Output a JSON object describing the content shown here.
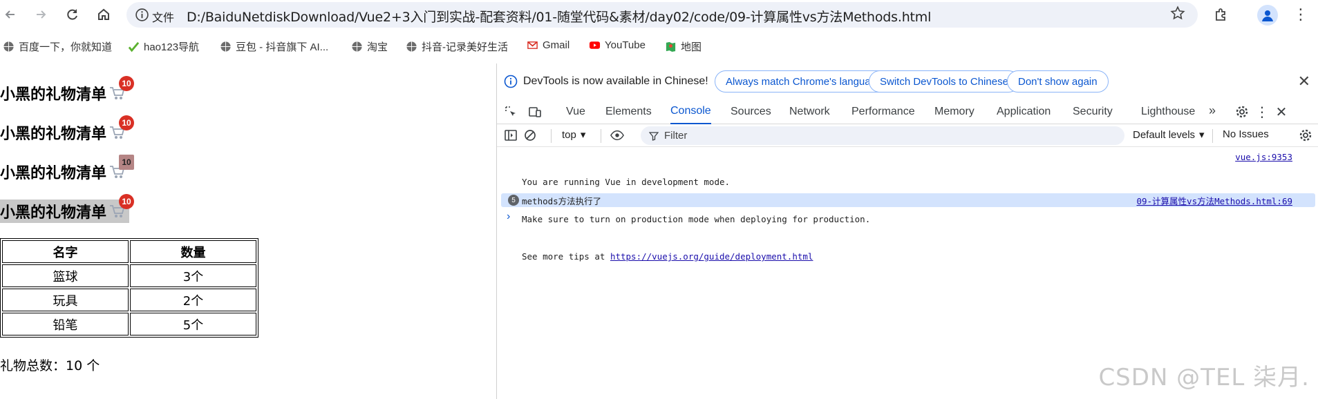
{
  "browser": {
    "omnibox": {
      "scheme_label": "文件",
      "url": "D:/BaiduNetdiskDownload/Vue2+3入门到实战-配套资料/01-随堂代码&素材/day02/code/09-计算属性vs方法Methods.html"
    },
    "bookmarks": [
      {
        "label": "百度一下，你就知道",
        "icon": "globe-icon"
      },
      {
        "label": "hao123导航",
        "icon": "hao123-icon"
      },
      {
        "label": "豆包 - 抖音旗下 AI...",
        "icon": "globe-icon"
      },
      {
        "label": "淘宝",
        "icon": "globe-icon"
      },
      {
        "label": "抖音-记录美好生活",
        "icon": "globe-icon"
      },
      {
        "label": "Gmail",
        "icon": "gmail-icon"
      },
      {
        "label": "YouTube",
        "icon": "youtube-icon"
      },
      {
        "label": "地图",
        "icon": "maps-icon"
      }
    ]
  },
  "page": {
    "titles": [
      {
        "text": "小黑的礼物清单",
        "badge": "10"
      },
      {
        "text": "小黑的礼物清单",
        "badge": "10"
      },
      {
        "text": "小黑的礼物清单",
        "badge": "10"
      },
      {
        "text": "小黑的礼物清单",
        "badge": "10"
      }
    ],
    "table": {
      "headers": [
        "名字",
        "数量"
      ],
      "rows": [
        [
          "篮球",
          "3个"
        ],
        [
          "玩具",
          "2个"
        ],
        [
          "铅笔",
          "5个"
        ]
      ]
    },
    "total_text": "礼物总数：10 个"
  },
  "devtools": {
    "infobar": {
      "message": "DevTools is now available in Chinese!",
      "btn_match": "Always match Chrome's language",
      "btn_switch": "Switch DevTools to Chinese",
      "btn_dont": "Don't show again"
    },
    "tabs": [
      "Vue",
      "Elements",
      "Console",
      "Sources",
      "Network",
      "Performance",
      "Memory",
      "Application",
      "Security",
      "Lighthouse"
    ],
    "active_tab": "Console",
    "toolbar": {
      "context": "top",
      "filter_placeholder": "Filter",
      "levels": "Default levels",
      "issues": "No Issues"
    },
    "console": {
      "vue_msg_line1": "You are running Vue in development mode.",
      "vue_msg_line2": "Make sure to turn on production mode when deploying for production.",
      "vue_msg_line3_prefix": "See more tips at ",
      "vue_msg_link": "https://vuejs.org/guide/deployment.html",
      "vue_msg_source": "vue.js:9353",
      "group_count": "5",
      "group_text": "methods方法执行了",
      "group_source": "09-计算属性vs方法Methods.html:69"
    }
  },
  "watermark": "CSDN @TEL 柒月."
}
